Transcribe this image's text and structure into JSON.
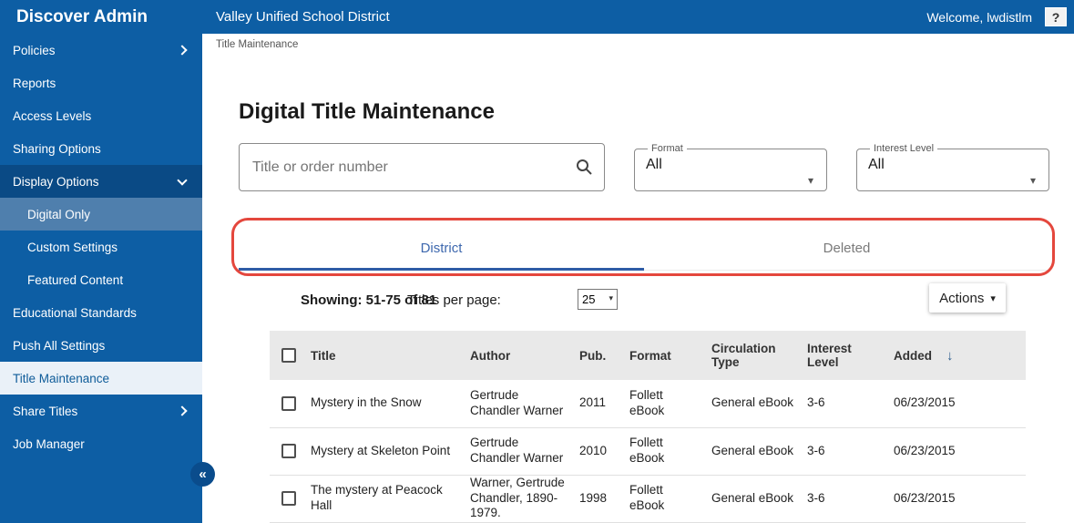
{
  "app": {
    "title": "Discover Admin",
    "district": "Valley Unified School District",
    "welcome": "Welcome, lwdistlm",
    "help": "?"
  },
  "sidebar": {
    "items": [
      {
        "label": "Policies",
        "chevron": "right"
      },
      {
        "label": "Reports"
      },
      {
        "label": "Access Levels"
      },
      {
        "label": "Sharing Options"
      },
      {
        "label": "Display Options",
        "chevron": "down",
        "state": "expanded"
      },
      {
        "label": "Digital Only",
        "sub": true,
        "state": "selected"
      },
      {
        "label": "Custom Settings",
        "sub": true
      },
      {
        "label": "Featured Content",
        "sub": true
      },
      {
        "label": "Educational Standards"
      },
      {
        "label": "Push All Settings"
      },
      {
        "label": "Title Maintenance",
        "state": "active"
      },
      {
        "label": "Share Titles",
        "chevron": "right"
      },
      {
        "label": "Job Manager"
      }
    ]
  },
  "breadcrumb": "Title Maintenance",
  "page": {
    "title": "Digital Title Maintenance"
  },
  "filters": {
    "search_placeholder": "Title or order number",
    "format": {
      "label": "Format",
      "value": "All"
    },
    "interest_level": {
      "label": "Interest Level",
      "value": "All"
    }
  },
  "tabs": [
    {
      "label": "District",
      "active": true
    },
    {
      "label": "Deleted",
      "active": false
    }
  ],
  "list_controls": {
    "showing": "Showing: 51-75 of 81",
    "per_page_label": "Titles per page:",
    "per_page_value": "25",
    "actions_label": "Actions"
  },
  "table": {
    "headers": [
      "Title",
      "Author",
      "Pub.",
      "Format",
      "Circulation Type",
      "Interest Level",
      "Added"
    ],
    "sort_column": "Added",
    "sort_direction": "desc",
    "rows": [
      {
        "title": "Mystery in the Snow",
        "author": "Gertrude Chandler Warner",
        "pub": "2011",
        "format": "Follett eBook",
        "circulation_type": "General eBook",
        "interest_level": "3-6",
        "added": "06/23/2015"
      },
      {
        "title": "Mystery at Skeleton Point",
        "author": "Gertrude Chandler Warner",
        "pub": "2010",
        "format": "Follett eBook",
        "circulation_type": "General eBook",
        "interest_level": "3-6",
        "added": "06/23/2015"
      },
      {
        "title": "The mystery at Peacock Hall",
        "author": "Warner, Gertrude Chandler, 1890-1979.",
        "pub": "1998",
        "format": "Follett eBook",
        "circulation_type": "General eBook",
        "interest_level": "3-6",
        "added": "06/23/2015"
      }
    ]
  },
  "icons": {
    "search": "magnifier",
    "collapse": "«",
    "actions_caret": "▾",
    "sort_desc": "↓",
    "select_caret": "▾"
  },
  "colors": {
    "brand_blue": "#0D5EA4",
    "expanded_item_bg": "#0A4A85",
    "subitem_selected_bg": "#4F7FAD",
    "active_item_bg": "#EAF1F8",
    "annotation_red": "#E4473D",
    "tab_active_blue": "#2E5CA6",
    "table_header_bg": "#E9E9E9"
  }
}
